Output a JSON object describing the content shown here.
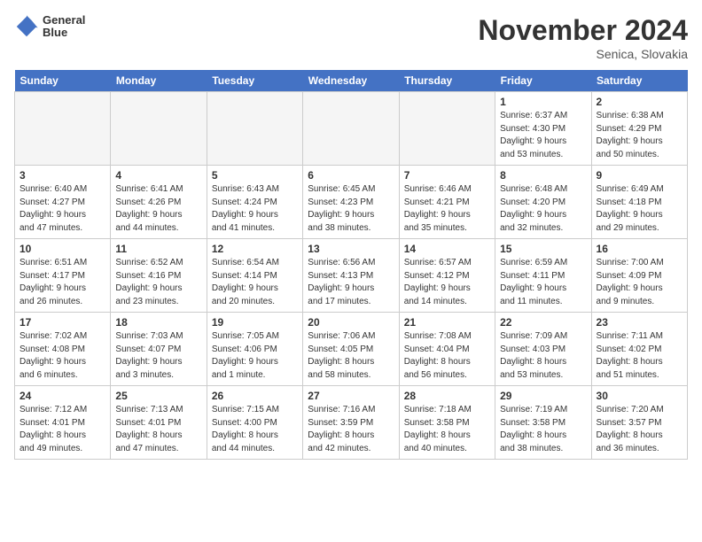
{
  "logo": {
    "line1": "General",
    "line2": "Blue"
  },
  "title": "November 2024",
  "subtitle": "Senica, Slovakia",
  "days_of_week": [
    "Sunday",
    "Monday",
    "Tuesday",
    "Wednesday",
    "Thursday",
    "Friday",
    "Saturday"
  ],
  "weeks": [
    [
      {
        "day": "",
        "info": ""
      },
      {
        "day": "",
        "info": ""
      },
      {
        "day": "",
        "info": ""
      },
      {
        "day": "",
        "info": ""
      },
      {
        "day": "",
        "info": ""
      },
      {
        "day": "1",
        "info": "Sunrise: 6:37 AM\nSunset: 4:30 PM\nDaylight: 9 hours\nand 53 minutes."
      },
      {
        "day": "2",
        "info": "Sunrise: 6:38 AM\nSunset: 4:29 PM\nDaylight: 9 hours\nand 50 minutes."
      }
    ],
    [
      {
        "day": "3",
        "info": "Sunrise: 6:40 AM\nSunset: 4:27 PM\nDaylight: 9 hours\nand 47 minutes."
      },
      {
        "day": "4",
        "info": "Sunrise: 6:41 AM\nSunset: 4:26 PM\nDaylight: 9 hours\nand 44 minutes."
      },
      {
        "day": "5",
        "info": "Sunrise: 6:43 AM\nSunset: 4:24 PM\nDaylight: 9 hours\nand 41 minutes."
      },
      {
        "day": "6",
        "info": "Sunrise: 6:45 AM\nSunset: 4:23 PM\nDaylight: 9 hours\nand 38 minutes."
      },
      {
        "day": "7",
        "info": "Sunrise: 6:46 AM\nSunset: 4:21 PM\nDaylight: 9 hours\nand 35 minutes."
      },
      {
        "day": "8",
        "info": "Sunrise: 6:48 AM\nSunset: 4:20 PM\nDaylight: 9 hours\nand 32 minutes."
      },
      {
        "day": "9",
        "info": "Sunrise: 6:49 AM\nSunset: 4:18 PM\nDaylight: 9 hours\nand 29 minutes."
      }
    ],
    [
      {
        "day": "10",
        "info": "Sunrise: 6:51 AM\nSunset: 4:17 PM\nDaylight: 9 hours\nand 26 minutes."
      },
      {
        "day": "11",
        "info": "Sunrise: 6:52 AM\nSunset: 4:16 PM\nDaylight: 9 hours\nand 23 minutes."
      },
      {
        "day": "12",
        "info": "Sunrise: 6:54 AM\nSunset: 4:14 PM\nDaylight: 9 hours\nand 20 minutes."
      },
      {
        "day": "13",
        "info": "Sunrise: 6:56 AM\nSunset: 4:13 PM\nDaylight: 9 hours\nand 17 minutes."
      },
      {
        "day": "14",
        "info": "Sunrise: 6:57 AM\nSunset: 4:12 PM\nDaylight: 9 hours\nand 14 minutes."
      },
      {
        "day": "15",
        "info": "Sunrise: 6:59 AM\nSunset: 4:11 PM\nDaylight: 9 hours\nand 11 minutes."
      },
      {
        "day": "16",
        "info": "Sunrise: 7:00 AM\nSunset: 4:09 PM\nDaylight: 9 hours\nand 9 minutes."
      }
    ],
    [
      {
        "day": "17",
        "info": "Sunrise: 7:02 AM\nSunset: 4:08 PM\nDaylight: 9 hours\nand 6 minutes."
      },
      {
        "day": "18",
        "info": "Sunrise: 7:03 AM\nSunset: 4:07 PM\nDaylight: 9 hours\nand 3 minutes."
      },
      {
        "day": "19",
        "info": "Sunrise: 7:05 AM\nSunset: 4:06 PM\nDaylight: 9 hours\nand 1 minute."
      },
      {
        "day": "20",
        "info": "Sunrise: 7:06 AM\nSunset: 4:05 PM\nDaylight: 8 hours\nand 58 minutes."
      },
      {
        "day": "21",
        "info": "Sunrise: 7:08 AM\nSunset: 4:04 PM\nDaylight: 8 hours\nand 56 minutes."
      },
      {
        "day": "22",
        "info": "Sunrise: 7:09 AM\nSunset: 4:03 PM\nDaylight: 8 hours\nand 53 minutes."
      },
      {
        "day": "23",
        "info": "Sunrise: 7:11 AM\nSunset: 4:02 PM\nDaylight: 8 hours\nand 51 minutes."
      }
    ],
    [
      {
        "day": "24",
        "info": "Sunrise: 7:12 AM\nSunset: 4:01 PM\nDaylight: 8 hours\nand 49 minutes."
      },
      {
        "day": "25",
        "info": "Sunrise: 7:13 AM\nSunset: 4:01 PM\nDaylight: 8 hours\nand 47 minutes."
      },
      {
        "day": "26",
        "info": "Sunrise: 7:15 AM\nSunset: 4:00 PM\nDaylight: 8 hours\nand 44 minutes."
      },
      {
        "day": "27",
        "info": "Sunrise: 7:16 AM\nSunset: 3:59 PM\nDaylight: 8 hours\nand 42 minutes."
      },
      {
        "day": "28",
        "info": "Sunrise: 7:18 AM\nSunset: 3:58 PM\nDaylight: 8 hours\nand 40 minutes."
      },
      {
        "day": "29",
        "info": "Sunrise: 7:19 AM\nSunset: 3:58 PM\nDaylight: 8 hours\nand 38 minutes."
      },
      {
        "day": "30",
        "info": "Sunrise: 7:20 AM\nSunset: 3:57 PM\nDaylight: 8 hours\nand 36 minutes."
      }
    ]
  ]
}
